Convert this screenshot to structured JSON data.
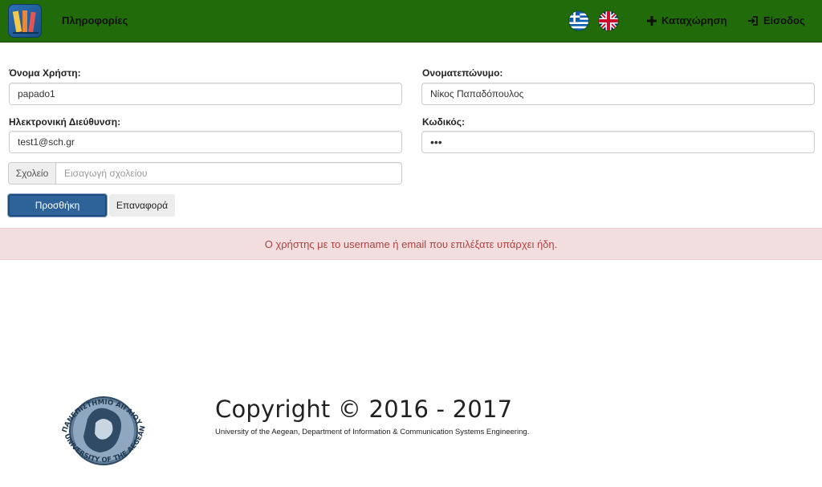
{
  "navbar": {
    "title": "Πληροφορίες",
    "register_label": "Καταχώρηση",
    "login_label": "Είσοδος",
    "brand_color": "#226b0a"
  },
  "form": {
    "username_label": "Όνομα Χρήστη:",
    "username_value": "papado1",
    "fullname_label": "Ονοματεπώνυμο:",
    "fullname_value": "Νίκος Παπαδόπουλος",
    "email_label": "Ηλεκτρονική Διεύθυνση:",
    "email_value": "test1@sch.gr",
    "password_label": "Κωδικός:",
    "password_value": "abc",
    "school_addon": "Σχολείο",
    "school_placeholder": "Εισαγωγή σχολείου",
    "school_value": "",
    "submit_label": "Προσθήκη",
    "reset_label": "Επαναφορά"
  },
  "alert": {
    "message": "Ο χρήστης με το username ή email που επιλέξατε υπάρχει ήδη.",
    "color": "#a94442"
  },
  "footer": {
    "copyright": "Copyright © 2016 - 2017",
    "subtitle": "University of the Aegean, Department of Information & Communication Systems Engineering.",
    "seal_text_greek": "ΠΑΝΕΠΙΣΤΗΜΙΟ ΑΙΓΑΙΟΥ",
    "seal_text_english": "UNIVERSITY OF THE AEGEAN"
  },
  "icons": {
    "brand": "books-logo-icon",
    "greek_flag": "greek-flag-icon",
    "uk_flag": "uk-flag-icon",
    "register": "plus-icon",
    "login": "login-icon"
  }
}
